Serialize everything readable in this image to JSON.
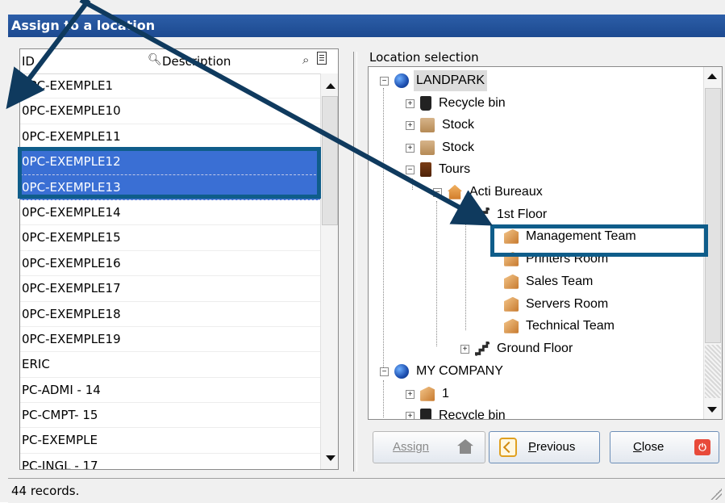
{
  "window": {
    "title": "Assign to a location"
  },
  "list": {
    "header_id": "ID",
    "header_description": "Description",
    "rows": [
      "0PC-EXEMPLE1",
      "0PC-EXEMPLE10",
      "0PC-EXEMPLE11",
      "0PC-EXEMPLE12",
      "0PC-EXEMPLE13",
      "0PC-EXEMPLE14",
      "0PC-EXEMPLE15",
      "0PC-EXEMPLE16",
      "0PC-EXEMPLE17",
      "0PC-EXEMPLE18",
      "0PC-EXEMPLE19",
      "ERIC",
      "PC-ADMI - 14",
      "PC-CMPT- 15",
      "PC-EXEMPLE",
      "PC-INGL - 17"
    ],
    "selected": [
      "0PC-EXEMPLE12",
      "0PC-EXEMPLE13"
    ]
  },
  "tree": {
    "label": "Location selection",
    "nodes": {
      "landpark": "LANDPARK",
      "recycle_bin": "Recycle bin",
      "stock1": "Stock",
      "stock2": "Stock",
      "tours": "Tours",
      "acti_bureaux": "Acti  Bureaux",
      "first_floor": "1st Floor",
      "management_team": "Management Team",
      "printers_room": "Printers Room",
      "sales_team": "Sales Team",
      "servers_room": "Servers Room",
      "technical_team": "Technical Team",
      "ground_floor": "Ground Floor",
      "my_company": "MY COMPANY",
      "node_1": "1",
      "recycle_bin_2": "Recycle bin"
    }
  },
  "buttons": {
    "assign": "Assign",
    "previous_underline": "P",
    "previous_rest": "revious",
    "close_underline": "C",
    "close_rest": "lose"
  },
  "status": {
    "records": "44 records."
  },
  "colors": {
    "title_bar": "#1d4a90",
    "selection": "#3a6fd4",
    "annotation": "#0f5d8a"
  },
  "icons": {
    "description_header": "magnifier-icon",
    "search": "search-icon",
    "filter": "filter-icon",
    "landpark": "globe-icon",
    "recycle_bin": "trash-icon",
    "stock": "box-icon",
    "tours": "door-icon",
    "acti_bureaux": "house-icon",
    "floor": "stairs-icon",
    "room": "room-icon",
    "assign": "home-icon",
    "previous": "back-arrow-icon",
    "close": "power-icon"
  }
}
